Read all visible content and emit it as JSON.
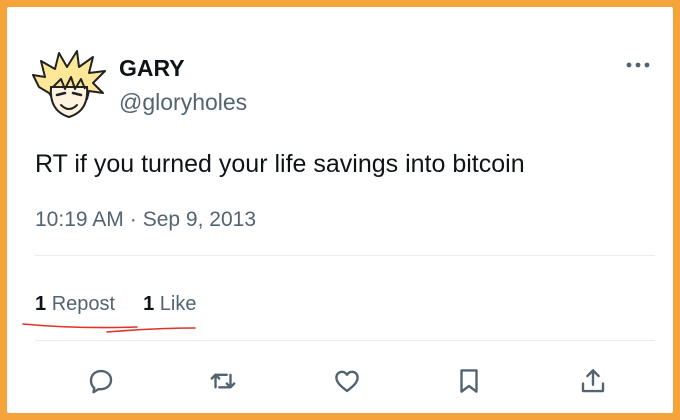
{
  "tweet": {
    "display_name": "GARY",
    "handle": "@gloryholes",
    "text": "RT if you turned your life savings into bitcoin",
    "time": "10:19 AM",
    "separator": "·",
    "date": "Sep 9, 2013",
    "more_glyph": "•••"
  },
  "stats": {
    "repost_count": "1",
    "repost_label": "Repost",
    "like_count": "1",
    "like_label": "Like"
  },
  "colors": {
    "frame": "#f4a43a",
    "text": "#0f1419",
    "muted": "#536471",
    "icon": "#536471",
    "annotation": "#e0322b"
  },
  "actions": [
    {
      "icon": "reply-icon"
    },
    {
      "icon": "repost-icon"
    },
    {
      "icon": "like-icon"
    },
    {
      "icon": "bookmark-icon"
    },
    {
      "icon": "share-icon"
    }
  ]
}
